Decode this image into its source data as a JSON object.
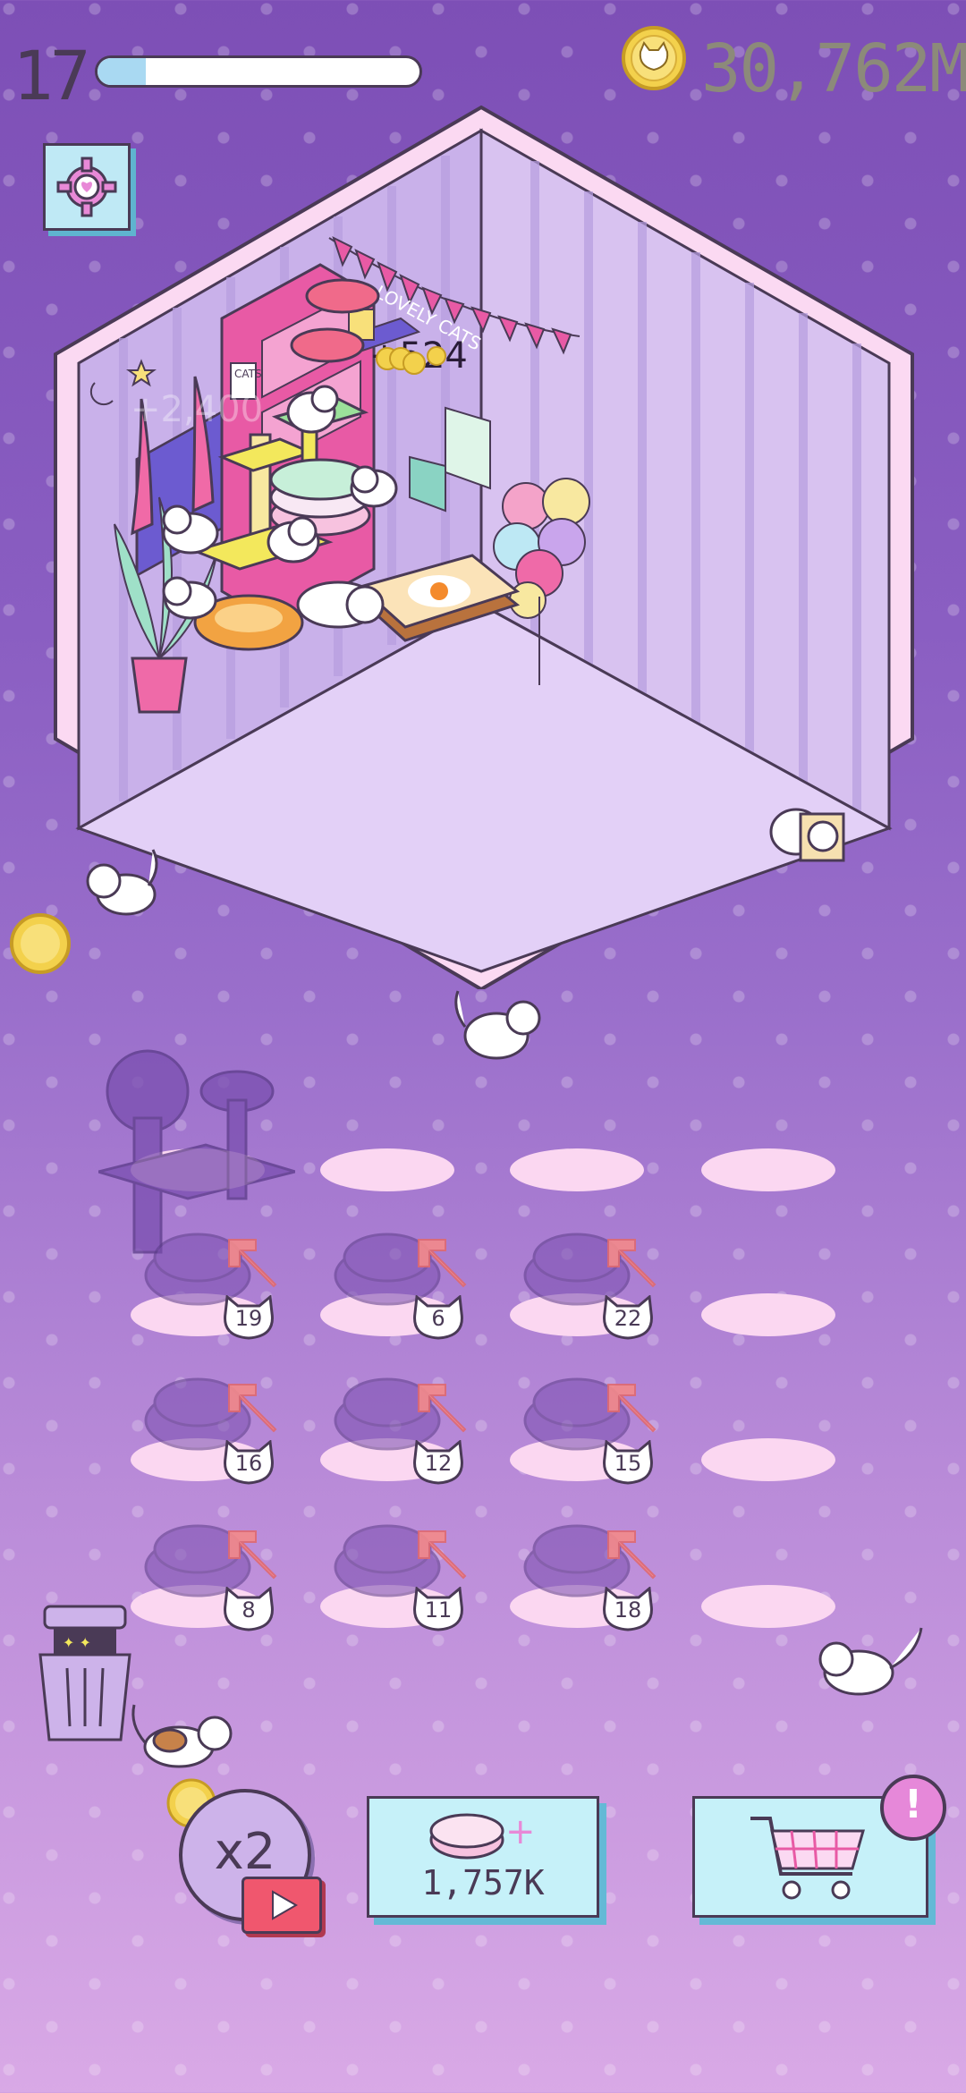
{
  "hud": {
    "level": "17",
    "xp_progress": 0.15,
    "coins": "30,762M"
  },
  "room": {
    "banner_text": "LOVELY CATS",
    "poster_text": "CATS",
    "floating_income_1": "+524",
    "floating_income_2": "+2,400"
  },
  "merge_grid": {
    "badges": [
      "19",
      "6",
      "22",
      "16",
      "12",
      "15",
      "8",
      "11",
      "18"
    ]
  },
  "bottom": {
    "boost_label": "x2",
    "buy_price": "1,757K",
    "alert": "!"
  },
  "colors": {
    "outline": "#4a3a56",
    "button_bg": "#c6f1f9",
    "button_shadow": "#64b9d6",
    "accent_pink": "#f0576e",
    "coin": "#f3d14c"
  },
  "icons": [
    "settings-gear-icon",
    "coin-icon",
    "cart-icon",
    "play-icon",
    "trash-icon",
    "cat-icon",
    "arrow-up-icon"
  ]
}
